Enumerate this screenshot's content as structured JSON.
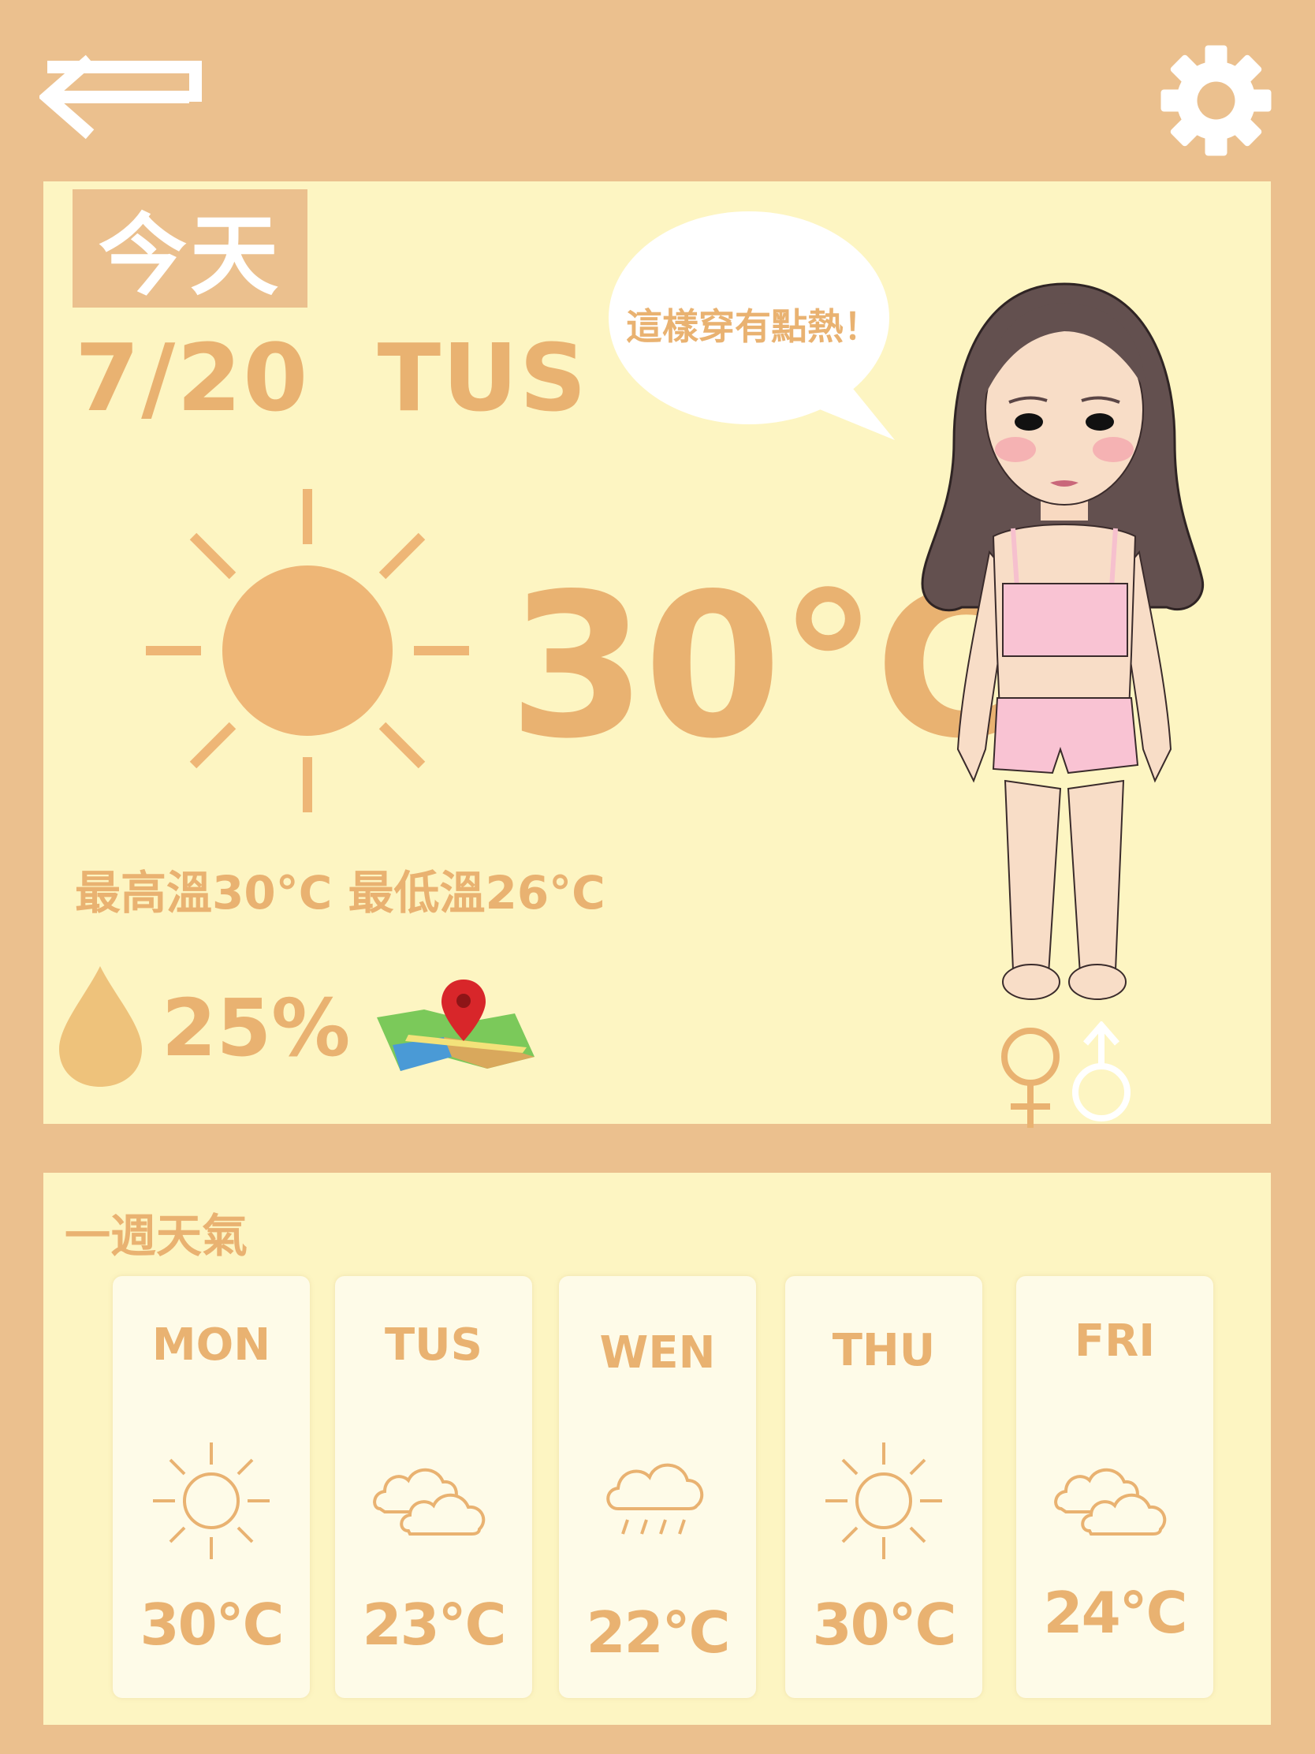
{
  "colors": {
    "background": "#EBC08E",
    "panel": "#FDF5C2",
    "accent": "#E9B271",
    "card": "#FEFBE8"
  },
  "top_bar": {
    "back_icon": "back-arrow-icon",
    "settings_icon": "gear-icon"
  },
  "today": {
    "badge": "今天",
    "date": "7/20  TUS",
    "weather_icon": "sun-icon",
    "temperature": "30°C",
    "high_low": "最高溫30°C 最低溫26°C",
    "humidity_icon": "water-drop-icon",
    "humidity": "25%",
    "map_icon": "map-pin-icon",
    "speech_bubble": "這樣穿有點熱！",
    "avatar": "girl-avatar",
    "gender_toggle": [
      "female-symbol-icon",
      "male-symbol-icon"
    ]
  },
  "week": {
    "title": "一週天氣",
    "days": [
      {
        "name": "MON",
        "icon": "sun-icon",
        "temp": "30°C"
      },
      {
        "name": "TUS",
        "icon": "cloud-icon",
        "temp": "23°C"
      },
      {
        "name": "WEN",
        "icon": "rain-icon",
        "temp": "22°C"
      },
      {
        "name": "THU",
        "icon": "sun-icon",
        "temp": "30°C"
      },
      {
        "name": "FRI",
        "icon": "cloud-icon",
        "temp": "24°C"
      }
    ]
  }
}
